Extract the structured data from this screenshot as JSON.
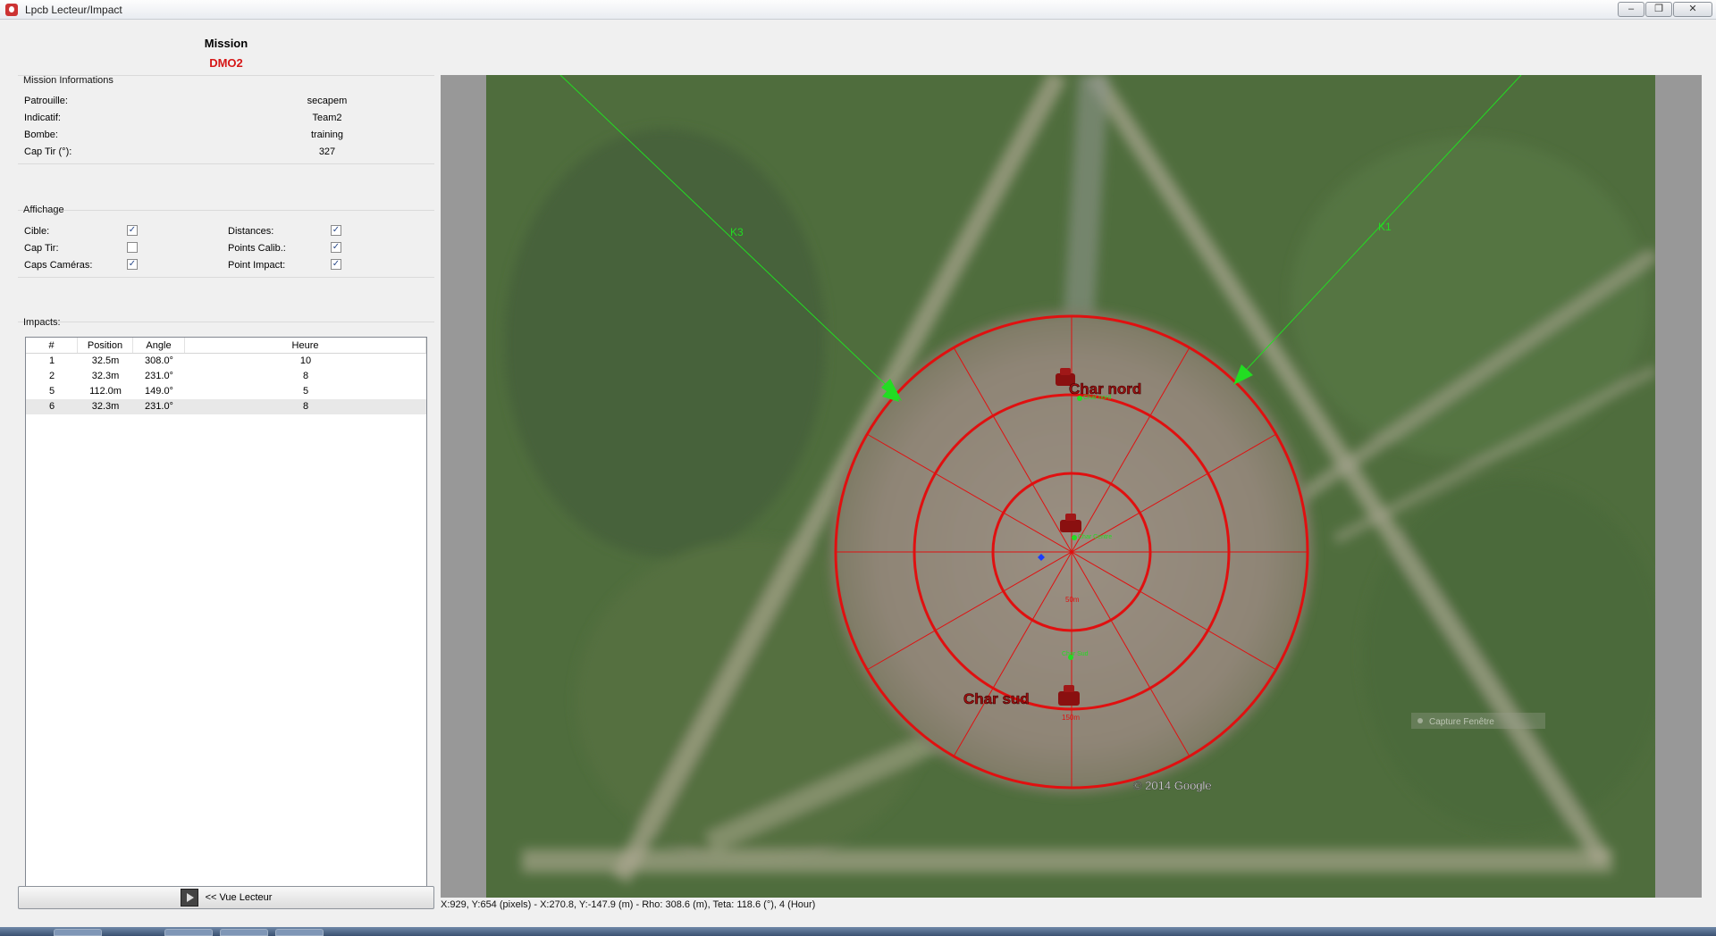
{
  "window": {
    "title": "Lpcb Lecteur/Impact",
    "btn_min": "‒",
    "btn_max": "❐",
    "btn_close": "✕"
  },
  "mission": {
    "label": "Mission",
    "code": "DMO2"
  },
  "info": {
    "group_title": "Mission Informations",
    "rows": [
      {
        "label": "Patrouille:",
        "value": "secapem"
      },
      {
        "label": "Indicatif:",
        "value": "Team2"
      },
      {
        "label": "Bombe:",
        "value": "training"
      },
      {
        "label": "Cap Tir (°):",
        "value": "327"
      }
    ]
  },
  "affichage": {
    "group_title": "Affichage",
    "items": [
      {
        "label": "Cible:",
        "checked": true
      },
      {
        "label": "Cap Tir:",
        "checked": false
      },
      {
        "label": "Caps Caméras:",
        "checked": true
      },
      {
        "label": "Distances:",
        "checked": true
      },
      {
        "label": "Points Calib.:",
        "checked": true
      },
      {
        "label": "Point Impact:",
        "checked": true
      }
    ]
  },
  "impacts": {
    "group_title": "Impacts:",
    "columns": [
      "#",
      "Position",
      "Angle",
      "Heure"
    ],
    "rows": [
      [
        "1",
        "32.5m",
        "308.0°",
        "10"
      ],
      [
        "2",
        "32.3m",
        "231.0°",
        "8"
      ],
      [
        "5",
        "112.0m",
        "149.0°",
        "5"
      ],
      [
        "6",
        "32.3m",
        "231.0°",
        "8"
      ]
    ]
  },
  "vue_button": {
    "label": "<< Vue Lecteur"
  },
  "map": {
    "camera_k3": "K3",
    "camera_k1": "K1",
    "target_north": "Char nord",
    "target_south": "Char sud",
    "ring_50": "50m",
    "ring_150": "150m",
    "small_label_center": "Char Centre",
    "small_label_north": "Char nord",
    "small_label_south": "Char Sud",
    "capture_label": "Capture Fenêtre",
    "copyright": "© 2014 Google",
    "accent_red": "#e01010",
    "accent_green": "#22dd22"
  },
  "status": "X:929, Y:654 (pixels) - X:270.8, Y:-147.9 (m) - Rho: 308.6 (m), Teta: 118.6 (°), 4 (Hour)"
}
